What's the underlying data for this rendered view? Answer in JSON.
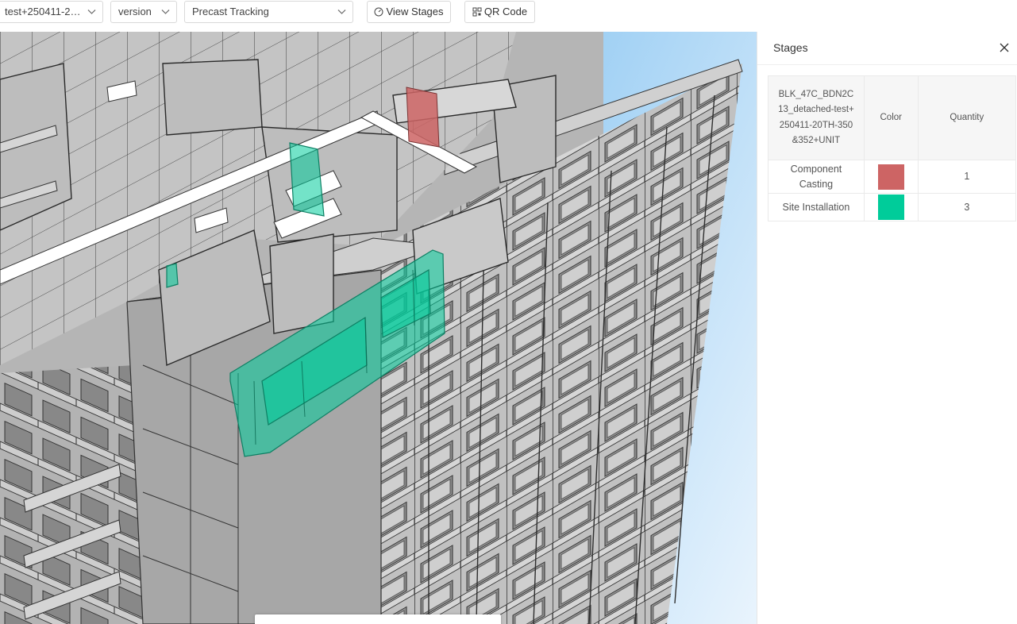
{
  "toolbar": {
    "model_select": "test+250411-20T...",
    "version_select": "version",
    "mode_select": "Precast Tracking",
    "view_stages_label": "View Stages",
    "qr_code_label": "QR Code"
  },
  "panel": {
    "title": "Stages",
    "table": {
      "headers": {
        "model": "BLK_47C_BDN2C13_detached-test+250411-20TH-350&352+UNIT",
        "color": "Color",
        "quantity": "Quantity"
      },
      "rows": [
        {
          "stage": "Component Casting",
          "color": "#cd6464",
          "quantity": "1"
        },
        {
          "stage": "Site Installation",
          "color": "#00cc9a",
          "quantity": "3"
        }
      ]
    }
  },
  "viewer_tools": [
    {
      "name": "home-icon"
    },
    {
      "name": "section-icon"
    },
    {
      "name": "measure-icon"
    },
    {
      "name": "walk-icon"
    },
    {
      "name": "properties-icon"
    },
    {
      "name": "model-settings-icon"
    },
    {
      "name": "fullscreen-icon"
    }
  ],
  "colors": {
    "sky_top": "#9fd0f4",
    "sky_bottom": "#eaf5fd",
    "concrete": "#b9b9b9",
    "highlight_casting": "#cd6464",
    "highlight_installation": "#00cc9a"
  }
}
